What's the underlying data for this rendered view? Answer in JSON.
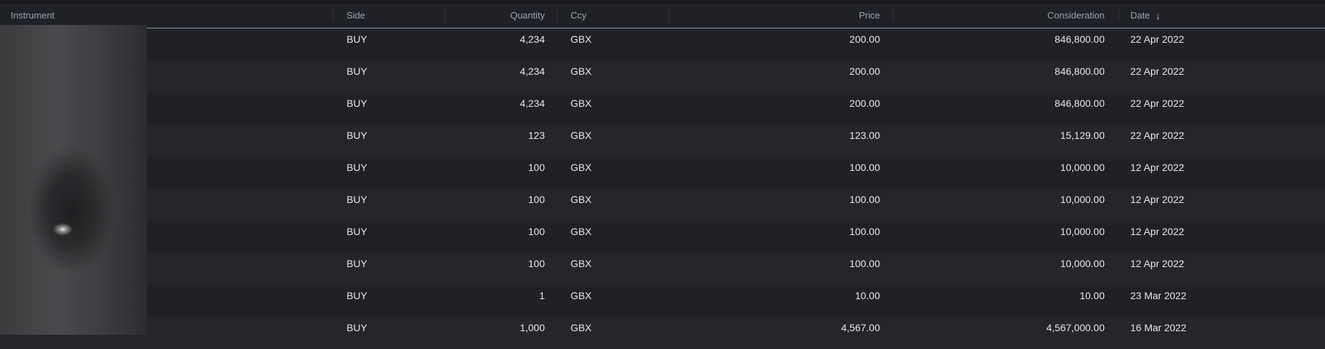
{
  "columns": {
    "instrument": "Instrument",
    "side": "Side",
    "quantity": "Quantity",
    "ccy": "Ccy",
    "price": "Price",
    "consideration": "Consideration",
    "date": "Date"
  },
  "sort": {
    "column": "date",
    "direction": "descending",
    "icon": "arrow-down-icon"
  },
  "rows": [
    {
      "side": "BUY",
      "quantity": "4,234",
      "ccy": "GBX",
      "price": "200.00",
      "consideration": "846,800.00",
      "date": "22 Apr 2022"
    },
    {
      "side": "BUY",
      "quantity": "4,234",
      "ccy": "GBX",
      "price": "200.00",
      "consideration": "846,800.00",
      "date": "22 Apr 2022"
    },
    {
      "side": "BUY",
      "quantity": "4,234",
      "ccy": "GBX",
      "price": "200.00",
      "consideration": "846,800.00",
      "date": "22 Apr 2022"
    },
    {
      "side": "BUY",
      "quantity": "123",
      "ccy": "GBX",
      "price": "123.00",
      "consideration": "15,129.00",
      "date": "22 Apr 2022"
    },
    {
      "side": "BUY",
      "quantity": "100",
      "ccy": "GBX",
      "price": "100.00",
      "consideration": "10,000.00",
      "date": "12 Apr 2022"
    },
    {
      "side": "BUY",
      "quantity": "100",
      "ccy": "GBX",
      "price": "100.00",
      "consideration": "10,000.00",
      "date": "12 Apr 2022"
    },
    {
      "side": "BUY",
      "quantity": "100",
      "ccy": "GBX",
      "price": "100.00",
      "consideration": "10,000.00",
      "date": "12 Apr 2022"
    },
    {
      "side": "BUY",
      "quantity": "100",
      "ccy": "GBX",
      "price": "100.00",
      "consideration": "10,000.00",
      "date": "12 Apr 2022"
    },
    {
      "side": "BUY",
      "quantity": "1",
      "ccy": "GBX",
      "price": "10.00",
      "consideration": "10.00",
      "date": "23 Mar 2022"
    },
    {
      "side": "BUY",
      "quantity": "1,000",
      "ccy": "GBX",
      "price": "4,567.00",
      "consideration": "4,567,000.00",
      "date": "16 Mar 2022"
    }
  ]
}
